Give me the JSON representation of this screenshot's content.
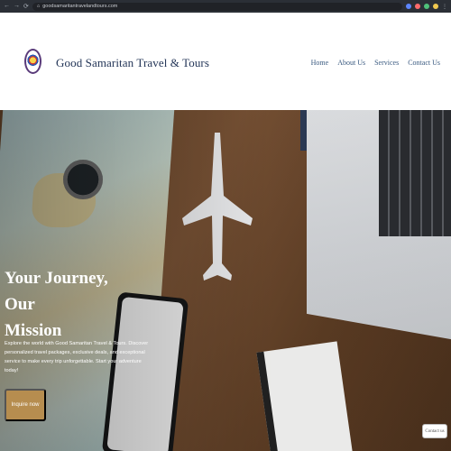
{
  "browser": {
    "url": "goodsamaritantravelandtours.com"
  },
  "site": {
    "brand_name": "Good Samaritan Travel & Tours",
    "nav": [
      "Home",
      "About Us",
      "Services",
      "Contact Us"
    ]
  },
  "hero": {
    "title_line1": "Your Journey, Our",
    "title_line2": "Mission",
    "description": "Explore the world with Good Samaritan Travel & Tours. Discover personalized travel packages, exclusive deals, and exceptional service to make every trip unforgettable. Start your adventure today!",
    "cta_label": "Inquire now"
  },
  "floating": {
    "contact_label": "Contact us"
  },
  "colors": {
    "brand_text": "#233557",
    "nav_text": "#3a5a80",
    "cta_bg": "#b68d4f"
  }
}
